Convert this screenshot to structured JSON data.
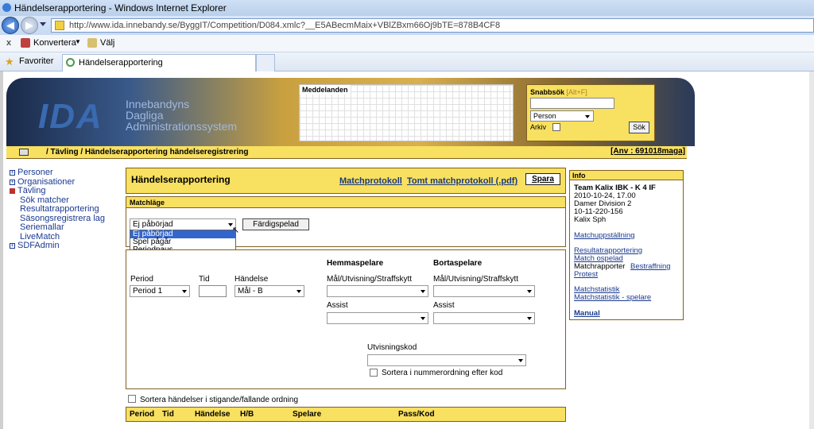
{
  "window": {
    "title": "Händelserapportering - Windows Internet Explorer"
  },
  "browser": {
    "url": "http://www.ida.innebandy.se/ByggIT/Competition/D084.xmlc?__E5ABecmMaix+VBlZBxm66Oj9bTE=878B4CF8",
    "cmd_close": "x",
    "cmd_convert": "Konvertera",
    "cmd_select": "Välj",
    "favorites": "Favoriter",
    "tab_title": "Händelserapportering"
  },
  "banner": {
    "logo": "IDA",
    "logo_line1": "Innebandyns",
    "logo_line2": "Dagliga",
    "logo_line3": "Administrationssystem",
    "messages_label": "Meddelanden",
    "quicksearch_label": "Snabbsök",
    "quicksearch_hint": "[Alt+F]",
    "quicksearch_type": "Person",
    "archive_label": "Arkiv",
    "search_button": "Sök"
  },
  "breadcrumb": {
    "path": "/ Tävling / Händelserapportering händelseregistrering",
    "user": "[Anv : 691018maga]"
  },
  "nav": [
    {
      "label": "Personer",
      "level": "top",
      "marker": "+"
    },
    {
      "label": "Organisationer",
      "level": "top",
      "marker": "+"
    },
    {
      "label": "Tävling",
      "level": "top",
      "marker": "-",
      "active": true
    },
    {
      "label": "Sök matcher",
      "level": "sub"
    },
    {
      "label": "Resultatrapportering",
      "level": "sub"
    },
    {
      "label": "Säsongsregistrera lag",
      "level": "sub"
    },
    {
      "label": "Seriemallar",
      "level": "sub"
    },
    {
      "label": "LiveMatch",
      "level": "sub"
    },
    {
      "label": "SDFAdmin",
      "level": "top",
      "marker": "+"
    }
  ],
  "main": {
    "title": "Händelserapportering",
    "link_protocol": "Matchprotokoll",
    "link_empty_protocol": "Tomt matchprotokoll (.pdf)",
    "save_button": "Spara",
    "matchstate_label": "Matchläge",
    "matchstate_value": "Ej påbörjad",
    "matchstate_options": [
      "Ej påbörjad",
      "Spel pågår",
      "Periodpaus"
    ],
    "finished_button": "Färdigspelad",
    "home_player": "Hemmaspelare",
    "away_player": "Bortaspelare",
    "period_label": "Period",
    "period_value": "Period 1",
    "time_label": "Tid",
    "event_label": "Händelse",
    "event_value": "Mål - B",
    "home_goal_label": "Mål/Utvisning/Straffskytt",
    "away_goal_label": "Mål/Utvisning/Straffskytt",
    "home_assist_label": "Assist",
    "away_assist_label": "Assist",
    "penalty_code_label": "Utvisningskod",
    "sort_by_number": "Sortera i nummerordning efter kod",
    "sort_events": "Sortera händelser i stigande/fallande ordning",
    "cols": [
      "Period",
      "Tid",
      "Händelse",
      "H/B",
      "Spelare",
      "Pass/Kod"
    ]
  },
  "info": {
    "header": "Info",
    "team": "Team Kalix IBK - K 4 IF",
    "datetime": "2010-10-24, 17.00",
    "division": "Damer Division 2",
    "match_no": "10-11-220-156",
    "venue": "Kalix Sph",
    "link_lineup": "Matchuppställning",
    "link_result": "Resultatrapportering",
    "link_unplayed": "Match ospelad",
    "reports_label": "Matchrapporter",
    "link_penalty": "Bestraffning",
    "link_protest": "Protest",
    "link_stats": "Matchstatistik",
    "link_player_stats": "Matchstatistik - spelare",
    "link_manual": "Manual"
  }
}
